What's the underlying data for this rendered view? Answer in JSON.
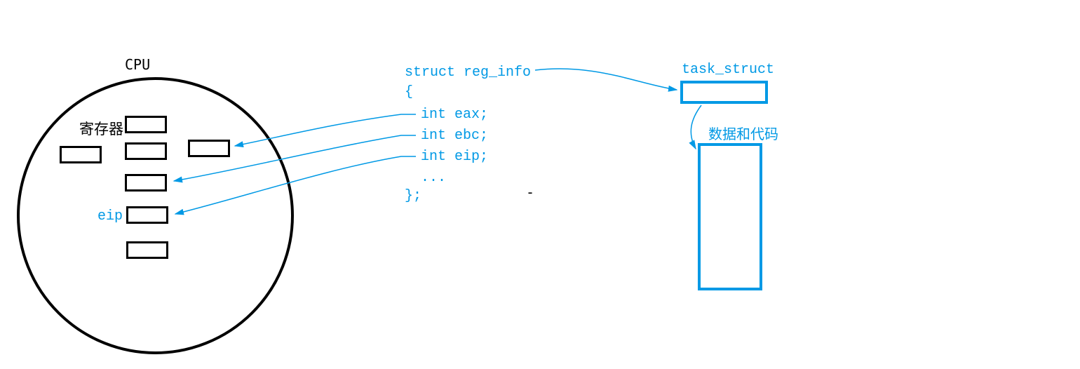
{
  "cpu": {
    "title": "CPU",
    "register_label": "寄存器",
    "eip_label": "eip"
  },
  "code": {
    "line1": "struct reg_info",
    "line2": "{",
    "line3": "int eax;",
    "line4": "int ebc;",
    "line5": "int eip;",
    "line6": "...",
    "line7": "};"
  },
  "task_struct_label": "task_struct",
  "data_code_label": "数据和代码",
  "dash": "-"
}
